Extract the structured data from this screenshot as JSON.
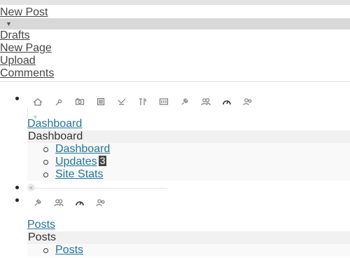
{
  "favorites": {
    "primary_label": "New Post",
    "toggle_icon": "triangle-down",
    "items": [
      {
        "label": "Drafts"
      },
      {
        "label": "New Page"
      },
      {
        "label": "Upload"
      },
      {
        "label": "Comments"
      }
    ]
  },
  "icon_row_1": [
    "home-icon",
    "pin-icon",
    "media-icon",
    "pages-icon",
    "comments-icon",
    "tools-icon",
    "settings-icon",
    "pushpin-icon",
    "users-icon",
    "gauge-icon",
    "users-group-icon"
  ],
  "dashboard_menu": {
    "link_label": "Dashboard",
    "heading": "Dashboard",
    "items": [
      {
        "label": "Dashboard"
      },
      {
        "label": "Updates",
        "count": "3"
      },
      {
        "label": "Site Stats"
      }
    ]
  },
  "collapse": {
    "glyph": "«"
  },
  "icon_row_2": [
    "pushpin-icon",
    "users-icon",
    "gauge-icon",
    "users-group-icon"
  ],
  "posts_menu": {
    "link_label": "Posts",
    "heading": "Posts",
    "items": [
      {
        "label": "Posts"
      }
    ]
  },
  "colors": {
    "link": "#21759b",
    "heading_bg": "#f1f1f1",
    "toggle_bg": "#d8d8d8",
    "badge_bg": "#464646"
  }
}
